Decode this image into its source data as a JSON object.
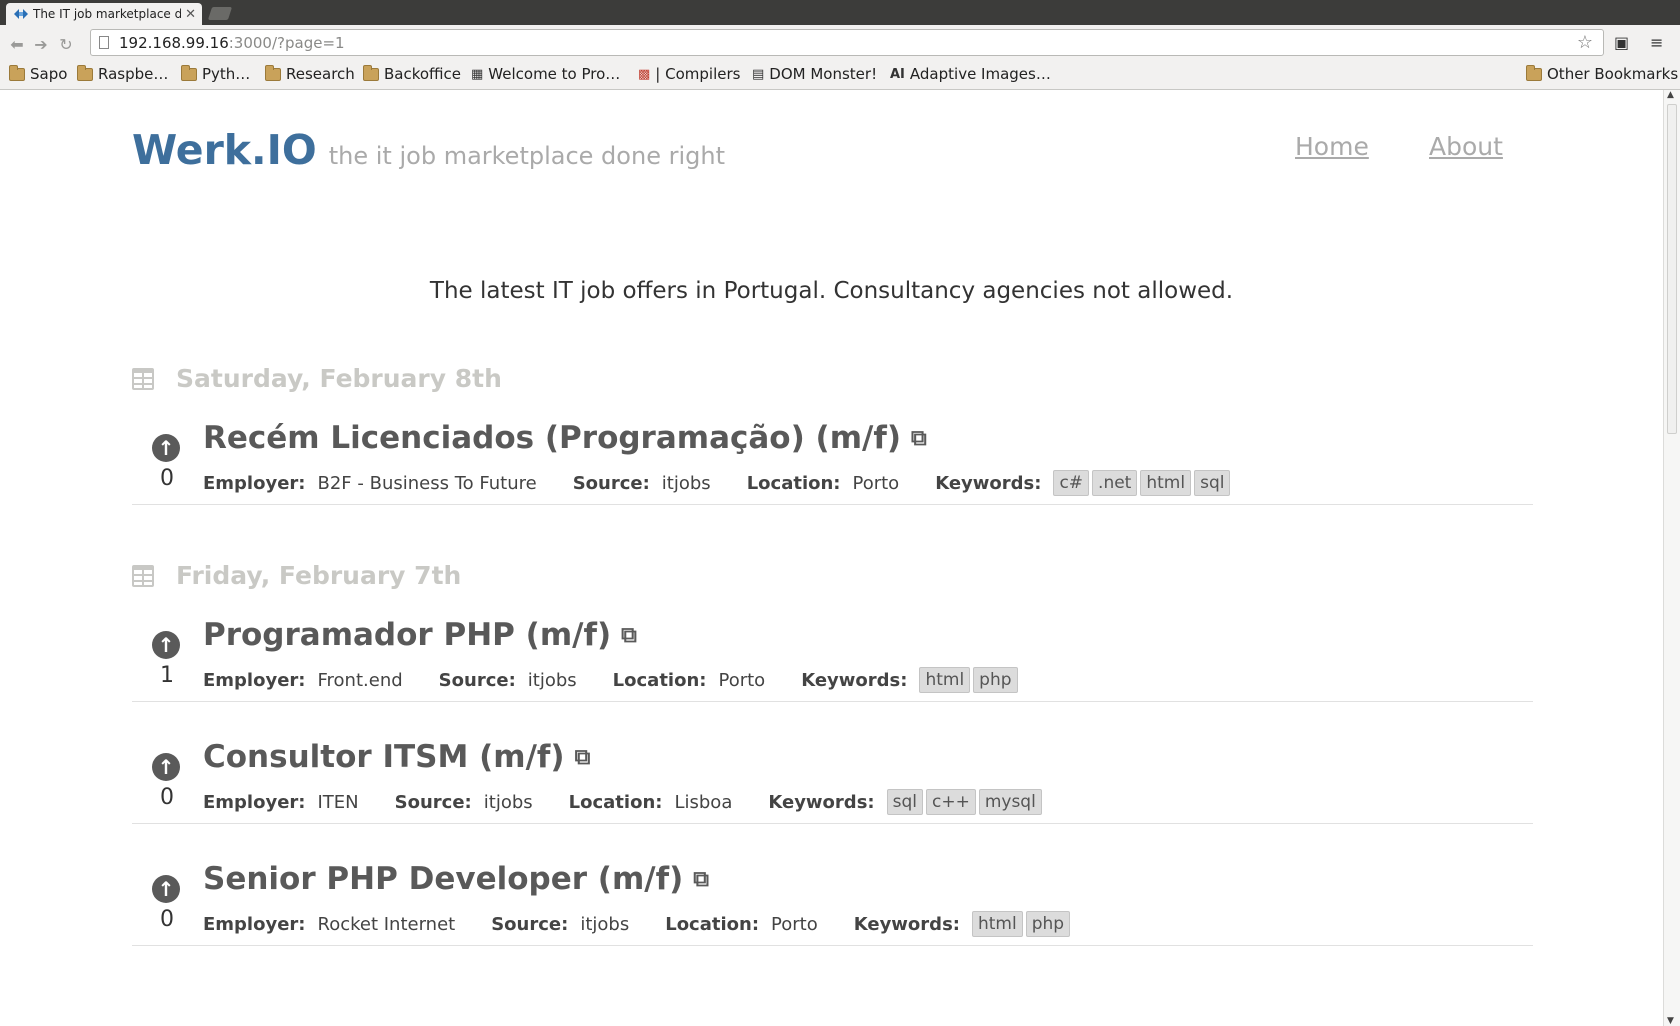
{
  "browser": {
    "tab_title": "The IT job marketplace dc",
    "url_host": "192.168.99.16",
    "url_path": ":3000/?page=1",
    "bookmarks": [
      {
        "label": "Sapo",
        "type": "folder"
      },
      {
        "label": "Raspbe…",
        "type": "folder"
      },
      {
        "label": "Pyth…",
        "type": "folder"
      },
      {
        "label": "Research",
        "type": "folder"
      },
      {
        "label": "Backoffice",
        "type": "folder"
      },
      {
        "label": "Welcome to Pro…",
        "type": "page"
      },
      {
        "label": "| Compilers",
        "type": "page"
      },
      {
        "label": "DOM Monster!",
        "type": "page"
      },
      {
        "label": "Adaptive Images…",
        "type": "page",
        "glyph": "AI"
      }
    ],
    "other_bookmarks": "Other Bookmarks"
  },
  "site": {
    "brand": "Werk.IO",
    "tagline": "the it job marketplace done right",
    "nav": [
      "Home",
      "About"
    ],
    "intro": "The latest IT job offers in Portugal. Consultancy agencies not allowed."
  },
  "labels": {
    "employer": "Employer:",
    "source": "Source:",
    "location": "Location:",
    "keywords": "Keywords:"
  },
  "days": [
    {
      "date": "Saturday, February 8th",
      "jobs": [
        {
          "title": "Recém Licenciados (Programação) (m/f)",
          "votes": "0",
          "employer": "B2F - Business To Future",
          "source": "itjobs",
          "location": "Porto",
          "keywords": [
            "c#",
            ".net",
            "html",
            "sql"
          ]
        }
      ]
    },
    {
      "date": "Friday, February 7th",
      "jobs": [
        {
          "title": "Programador PHP (m/f)",
          "votes": "1",
          "employer": "Front.end",
          "source": "itjobs",
          "location": "Porto",
          "keywords": [
            "html",
            "php"
          ]
        },
        {
          "title": "Consultor ITSM (m/f)",
          "votes": "0",
          "employer": "ITEN",
          "source": "itjobs",
          "location": "Lisboa",
          "keywords": [
            "sql",
            "c++",
            "mysql"
          ]
        },
        {
          "title": "Senior PHP Developer (m/f)",
          "votes": "0",
          "employer": "Rocket Internet",
          "source": "itjobs",
          "location": "Porto",
          "keywords": [
            "html",
            "php"
          ]
        }
      ]
    }
  ],
  "colors": {
    "brand": "#3e6f9c",
    "muted": "#aaaaaa",
    "day_label": "#c9c9c5",
    "job_title": "#595959"
  }
}
